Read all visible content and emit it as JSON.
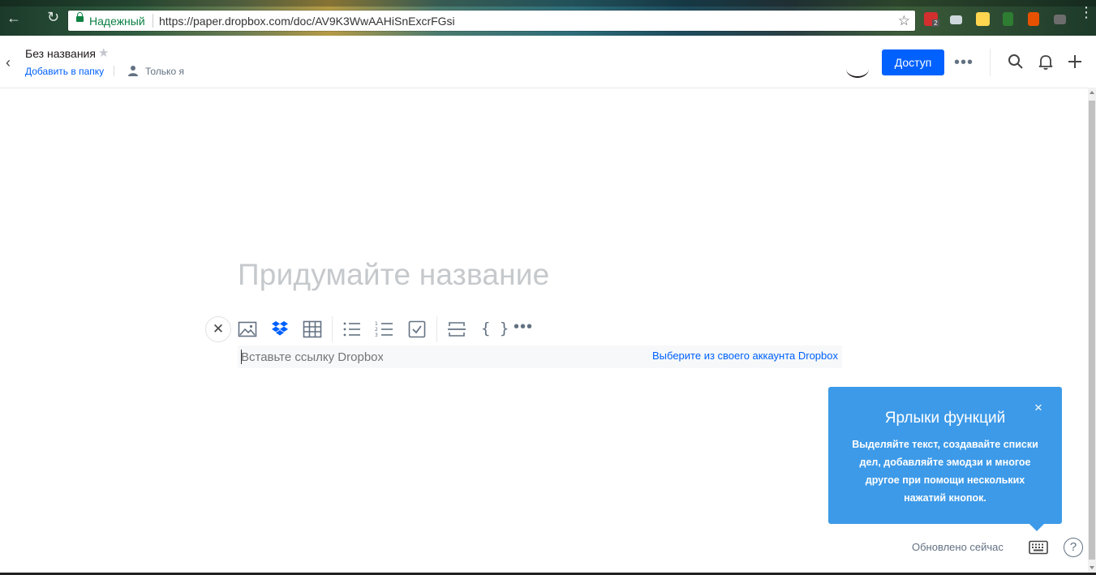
{
  "browser": {
    "secure_label": "Надежный",
    "url": "https://paper.dropbox.com/doc/AV9K3WwAAHiSnExcrFGsi",
    "extension_badge": "2"
  },
  "header": {
    "doc_title": "Без названия",
    "add_to_folder": "Добавить в папку",
    "visibility": "Только я",
    "share_label": "Доступ",
    "more_label": "•••"
  },
  "editor": {
    "title_placeholder": "Придумайте название",
    "link_placeholder": "Вставьте ссылку Dropbox",
    "choose_account": "Выберите из своего аккаунта Dropbox",
    "code_braces": "{ }",
    "more_label": "•••"
  },
  "tooltip": {
    "title": "Ярлыки функций",
    "body": "Выделяйте текст, создавайте списки дел, добавляйте эмодзи и многое другое при помощи нескольких нажатий кнопок.",
    "close": "×"
  },
  "footer": {
    "updated": "Обновлено сейчас",
    "help": "?"
  },
  "colors": {
    "accent": "#0061fe",
    "tooltip_bg": "#3d9ae8"
  }
}
